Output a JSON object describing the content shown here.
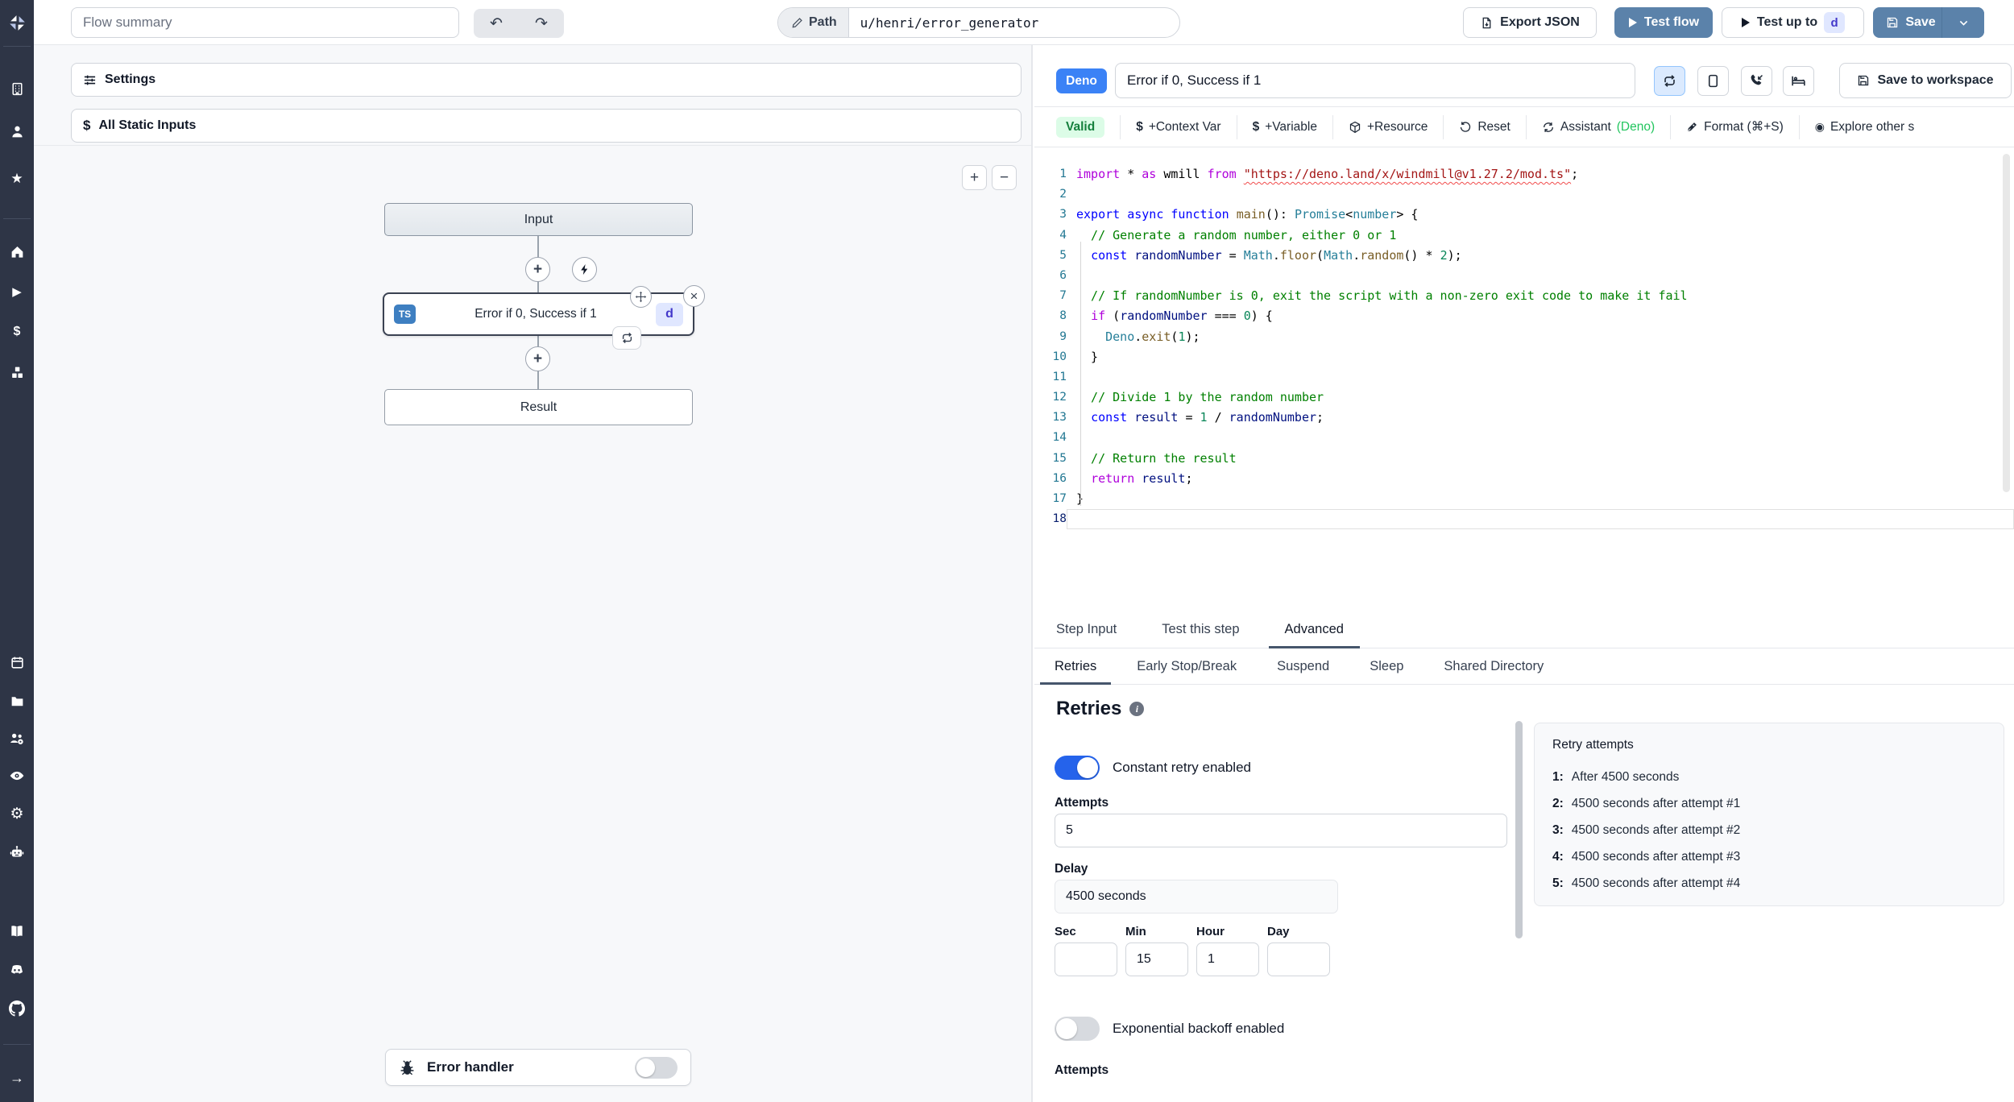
{
  "colors": {
    "accent_button_blue": "#5b82aa",
    "deno_badge_blue": "#3b82f6",
    "toggle_on_blue": "#2563eb",
    "valid_bg": "#dcfce7",
    "valid_text": "#15803d",
    "assistant_green": "#22c55e",
    "sidebar_bg": "#2e3546",
    "ts_badge_blue": "#3e7fc1",
    "d_badge_bg": "#e0e7ff",
    "d_badge_text": "#4338ca"
  },
  "icons": {
    "undo": "↶",
    "redo": "↷",
    "star": "★",
    "play": "▶",
    "dollar": "$",
    "gear": "⚙",
    "arrow_right": "→",
    "close": "×",
    "plus": "+",
    "zoom_in": "+",
    "zoom_out": "−",
    "explore": "◉",
    "info": "i",
    "command": "⌘"
  },
  "sidebar": {
    "items": [
      "workspace",
      "user",
      "favorites",
      "home",
      "runs",
      "variables",
      "resources",
      "schedules",
      "folders",
      "groups",
      "audit-logs",
      "settings",
      "workers",
      "docs",
      "discord",
      "github",
      "expand"
    ]
  },
  "topbar": {
    "flow_summary_placeholder": "Flow summary",
    "path_label": "Path",
    "path_value": "u/henri/error_generator",
    "export_json": "Export JSON",
    "test_flow": "Test flow",
    "test_up_to": "Test up to",
    "test_up_to_badge": "d",
    "save": "Save"
  },
  "left_panel": {
    "settings": "Settings",
    "all_static_inputs": "All Static Inputs",
    "graph": {
      "input_node": "Input",
      "step_title": "Error if 0, Success if 1",
      "step_lang_badge": "TS",
      "step_id_badge": "d",
      "result_node": "Result",
      "error_handler": "Error handler"
    }
  },
  "step_editor": {
    "lang_badge": "Deno",
    "step_name": "Error if 0, Success if 1",
    "save_to_workspace": "Save to workspace",
    "toolbar": {
      "valid": "Valid",
      "context_var": "+Context Var",
      "variable": "+Variable",
      "resource": "+Resource",
      "reset": "Reset",
      "assistant": "Assistant",
      "assistant_lang": "(Deno)",
      "format": "Format (⌘+S)",
      "explore": "Explore other s"
    }
  },
  "editor": {
    "lines": [
      {
        "n": 1,
        "t": [
          [
            "k2",
            "import"
          ],
          [
            "pl",
            " * "
          ],
          [
            "k2",
            "as"
          ],
          [
            "pl",
            " wmill "
          ],
          [
            "k2",
            "from"
          ],
          [
            "pl",
            " "
          ],
          [
            "su",
            "\"https://deno.land/x/windmill@v1.27.2/mod.ts\""
          ],
          [
            "pl",
            ";"
          ]
        ]
      },
      {
        "n": 2,
        "t": []
      },
      {
        "n": 3,
        "t": [
          [
            "k",
            "export"
          ],
          [
            "pl",
            " "
          ],
          [
            "k",
            "async"
          ],
          [
            "pl",
            " "
          ],
          [
            "k",
            "function"
          ],
          [
            "pl",
            " "
          ],
          [
            "fn",
            "main"
          ],
          [
            "pl",
            "(): "
          ],
          [
            "ty",
            "Promise"
          ],
          [
            "pl",
            "<"
          ],
          [
            "ty",
            "number"
          ],
          [
            "pl",
            "> {"
          ]
        ]
      },
      {
        "n": 4,
        "t": [
          [
            "cm",
            "  // Generate a random number, either 0 or 1"
          ]
        ]
      },
      {
        "n": 5,
        "t": [
          [
            "pl",
            "  "
          ],
          [
            "k",
            "const"
          ],
          [
            "pl",
            " "
          ],
          [
            "vr",
            "randomNumber"
          ],
          [
            "pl",
            " = "
          ],
          [
            "ty",
            "Math"
          ],
          [
            "pl",
            "."
          ],
          [
            "fn",
            "floor"
          ],
          [
            "pl",
            "("
          ],
          [
            "ty",
            "Math"
          ],
          [
            "pl",
            "."
          ],
          [
            "fn",
            "random"
          ],
          [
            "pl",
            "() * "
          ],
          [
            "nu",
            "2"
          ],
          [
            "pl",
            ");"
          ]
        ]
      },
      {
        "n": 6,
        "t": []
      },
      {
        "n": 7,
        "t": [
          [
            "cm",
            "  // If randomNumber is 0, exit the script with a non-zero exit code to make it fail"
          ]
        ]
      },
      {
        "n": 8,
        "t": [
          [
            "pl",
            "  "
          ],
          [
            "k2",
            "if"
          ],
          [
            "pl",
            " ("
          ],
          [
            "vr",
            "randomNumber"
          ],
          [
            "pl",
            " === "
          ],
          [
            "nu",
            "0"
          ],
          [
            "pl",
            ") {"
          ]
        ]
      },
      {
        "n": 9,
        "t": [
          [
            "pl",
            "    "
          ],
          [
            "ty",
            "Deno"
          ],
          [
            "pl",
            "."
          ],
          [
            "fn",
            "exit"
          ],
          [
            "pl",
            "("
          ],
          [
            "nu",
            "1"
          ],
          [
            "pl",
            ");"
          ]
        ]
      },
      {
        "n": 10,
        "t": [
          [
            "pl",
            "  }"
          ]
        ]
      },
      {
        "n": 11,
        "t": []
      },
      {
        "n": 12,
        "t": [
          [
            "cm",
            "  // Divide 1 by the random number"
          ]
        ]
      },
      {
        "n": 13,
        "t": [
          [
            "pl",
            "  "
          ],
          [
            "k",
            "const"
          ],
          [
            "pl",
            " "
          ],
          [
            "vr",
            "result"
          ],
          [
            "pl",
            " = "
          ],
          [
            "nu",
            "1"
          ],
          [
            "pl",
            " / "
          ],
          [
            "vr",
            "randomNumber"
          ],
          [
            "pl",
            ";"
          ]
        ]
      },
      {
        "n": 14,
        "t": []
      },
      {
        "n": 15,
        "t": [
          [
            "cm",
            "  // Return the result"
          ]
        ]
      },
      {
        "n": 16,
        "t": [
          [
            "pl",
            "  "
          ],
          [
            "k2",
            "return"
          ],
          [
            "pl",
            " "
          ],
          [
            "vr",
            "result"
          ],
          [
            "pl",
            ";"
          ]
        ]
      },
      {
        "n": 17,
        "t": [
          [
            "pl",
            "}"
          ]
        ]
      },
      {
        "n": 18,
        "t": [],
        "current": true
      }
    ]
  },
  "tabs": {
    "main": [
      "Step Input",
      "Test this step",
      "Advanced"
    ],
    "active_main": "Advanced",
    "advanced": [
      "Retries",
      "Early Stop/Break",
      "Suspend",
      "Sleep",
      "Shared Directory"
    ],
    "active_advanced": "Retries"
  },
  "retries": {
    "heading": "Retries",
    "constant_toggle_label": "Constant retry enabled",
    "constant_enabled": true,
    "attempts_label": "Attempts",
    "attempts_value": "5",
    "delay_label": "Delay",
    "delay_value": "4500 seconds",
    "time_fields": [
      {
        "label": "Sec",
        "value": ""
      },
      {
        "label": "Min",
        "value": "15"
      },
      {
        "label": "Hour",
        "value": "1"
      },
      {
        "label": "Day",
        "value": ""
      }
    ],
    "exponential_toggle_label": "Exponential backoff enabled",
    "exponential_enabled": false,
    "clipped_label": "Attempts",
    "preview": {
      "title": "Retry attempts",
      "items": [
        {
          "n": "1:",
          "text": "After 4500 seconds"
        },
        {
          "n": "2:",
          "text": "4500 seconds after attempt #1"
        },
        {
          "n": "3:",
          "text": "4500 seconds after attempt #2"
        },
        {
          "n": "4:",
          "text": "4500 seconds after attempt #3"
        },
        {
          "n": "5:",
          "text": "4500 seconds after attempt #4"
        }
      ]
    }
  }
}
